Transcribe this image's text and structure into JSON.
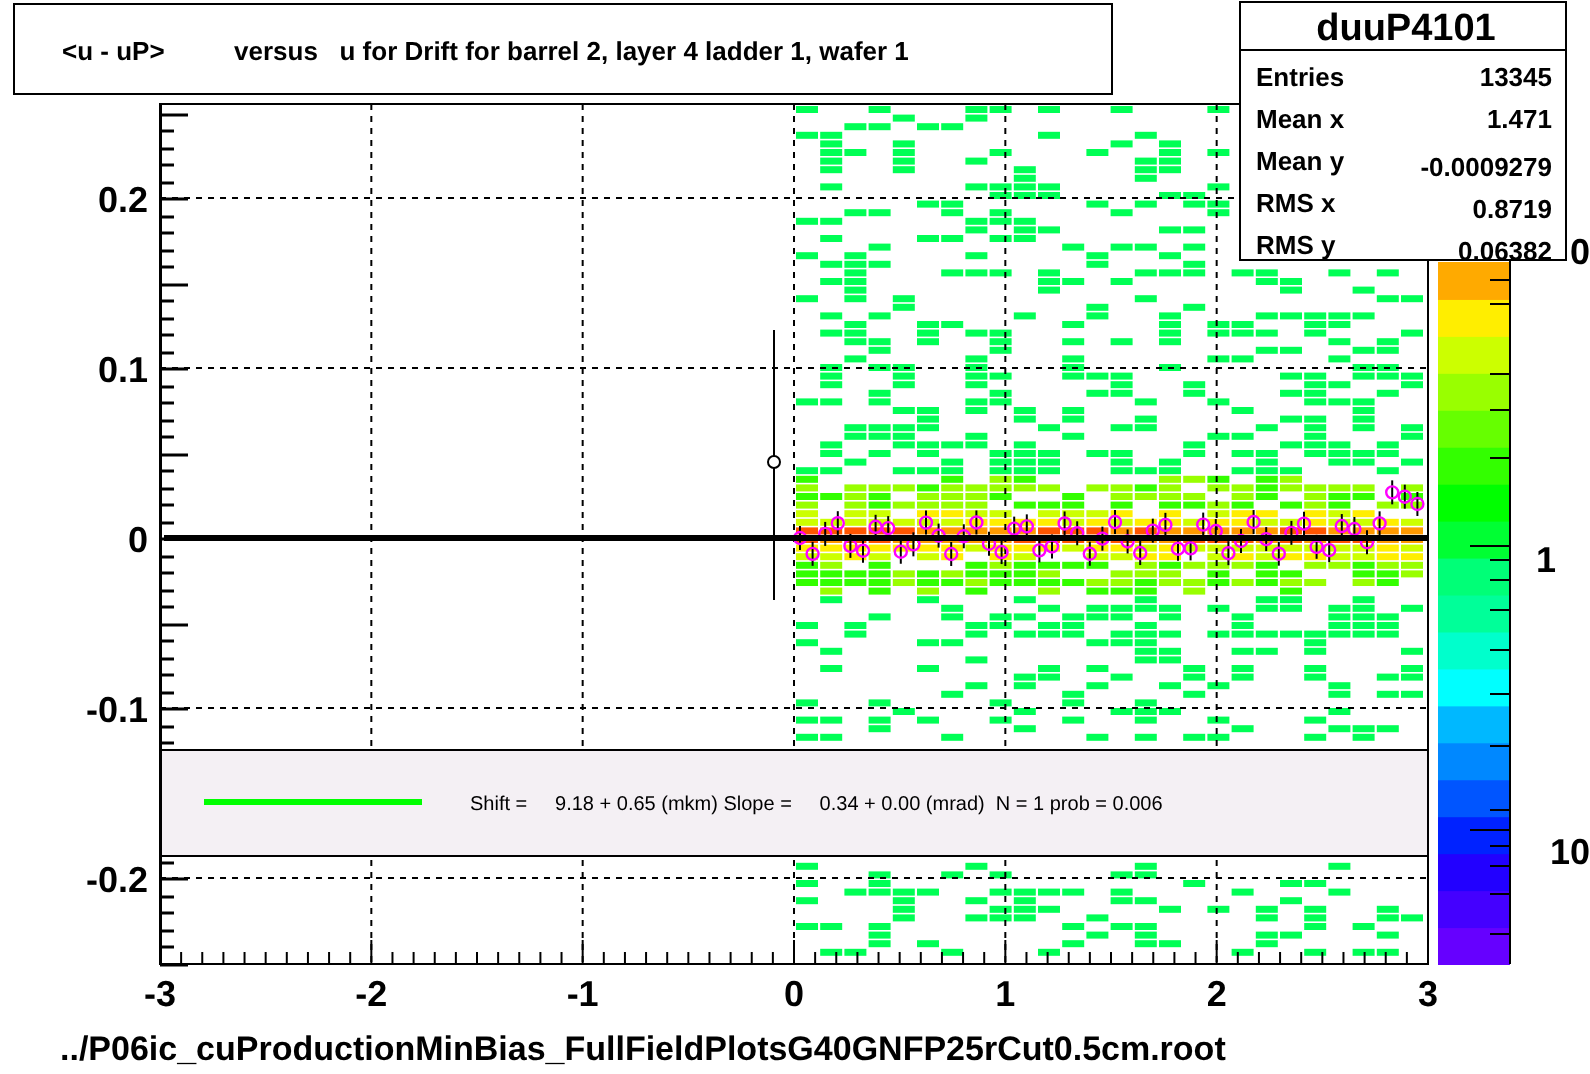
{
  "title": {
    "left": "<u - uP>",
    "right": "versus   u for Drift for barrel 2, layer 4 ladder 1, wafer 1"
  },
  "stats": {
    "name": "duuP4101",
    "rows": [
      {
        "label": "Entries",
        "value": "13345"
      },
      {
        "label": "Mean x",
        "value": "1.471"
      },
      {
        "label": "Mean y",
        "value": "-0.0009279"
      },
      {
        "label": "RMS x",
        "value": "0.8719"
      },
      {
        "label": "RMS y",
        "value": "0.06382"
      }
    ]
  },
  "legend": {
    "text": "Shift =     9.18 + 0.65 (mkm) Slope =     0.34 + 0.00 (mrad)  N = 1 prob = 0.006"
  },
  "x_axis": {
    "ticks": [
      "-3",
      "-2",
      "-1",
      "0",
      "1",
      "2",
      "3"
    ]
  },
  "y_axis": {
    "ticks": [
      "0.2",
      "0.1",
      "0",
      "-0.1",
      "-0.2"
    ]
  },
  "color_scale": {
    "labels": [
      "0",
      "1",
      "10"
    ]
  },
  "filename": "../P06ic_cuProductionMinBias_FullFieldPlotsG40GNFP25rCut0.5cm.root"
}
